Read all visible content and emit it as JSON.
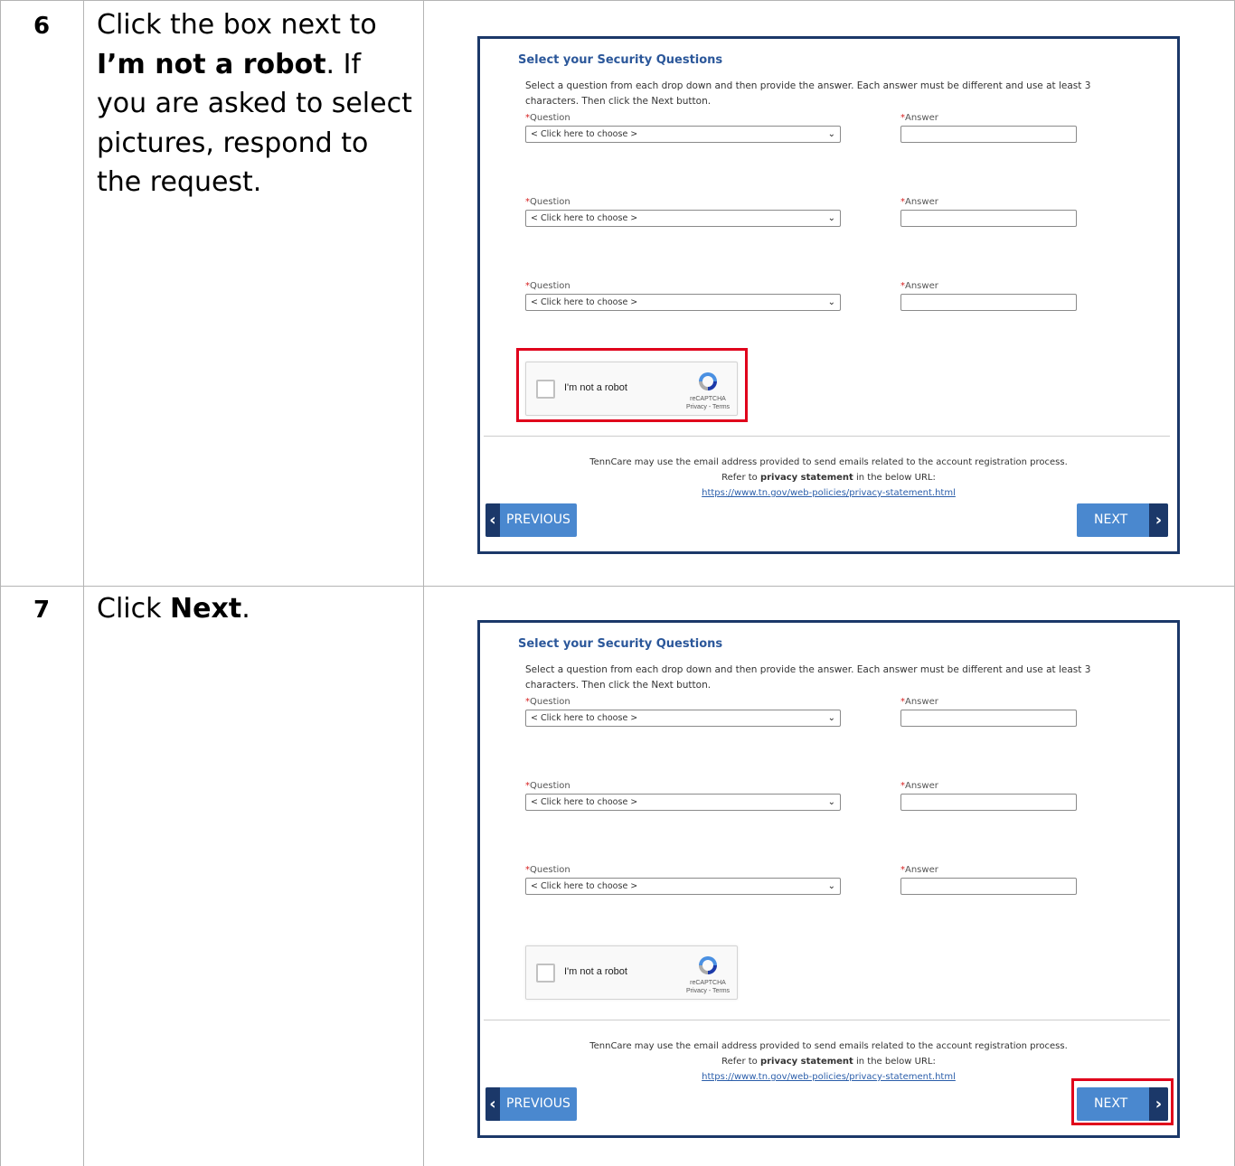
{
  "steps": [
    {
      "number": "6",
      "text_part1": "Click the box next to ",
      "text_bold": "I’m not a robot",
      "text_part2": ". If you are asked to select pictures, respond to the request.",
      "highlight": "captcha"
    },
    {
      "number": "7",
      "text_part1": "Click ",
      "text_bold": "Next",
      "text_part2": ".",
      "highlight": "next-button"
    }
  ],
  "form": {
    "heading": "Select your Security Questions",
    "instruction": "Select a question from each drop down and then provide the answer. Each answer must be different and use at least 3 characters. Then click the Next button.",
    "required_mark": "*",
    "question_label": "Question",
    "answer_label": "Answer",
    "select_placeholder": "< Click here to choose >",
    "question_rows": 3,
    "captcha": {
      "label": "I'm not a robot",
      "brand": "reCAPTCHA",
      "links": "Privacy - Terms"
    },
    "note": {
      "line1": "TennCare may use the email address provided to send emails related to the account registration process.",
      "line2_prefix": "Refer to ",
      "line2_bold": "privacy statement",
      "line2_suffix": " in the below URL:",
      "url": "https://www.tn.gov/web-policies/privacy-statement.html"
    },
    "prev_label": "PREVIOUS",
    "next_label": "NEXT"
  },
  "colors": {
    "frame_border": "#1b3869",
    "heading": "#2b579a",
    "button": "#4a88cf",
    "button_cap": "#1b3869",
    "highlight": "#e0001b",
    "required": "#d62020"
  }
}
